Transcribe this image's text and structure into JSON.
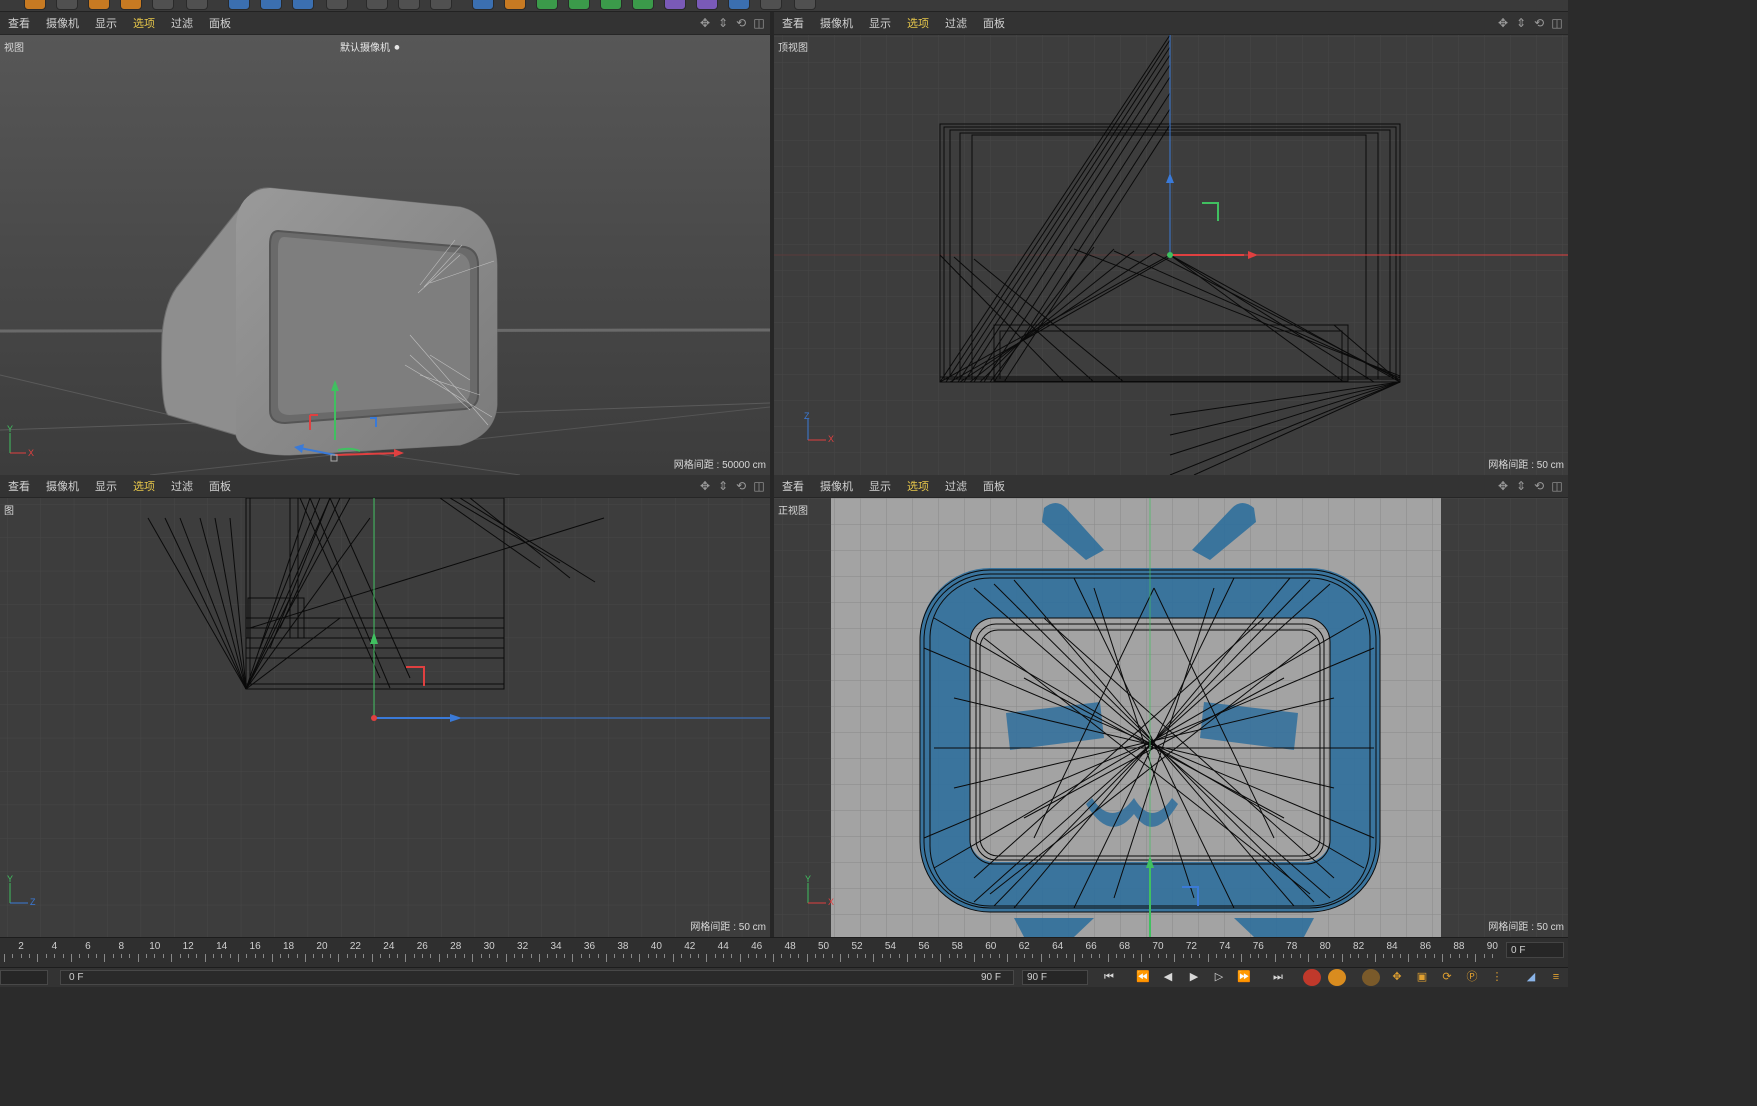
{
  "menus": [
    "查看",
    "摄像机",
    "显示",
    "选项",
    "过滤",
    "面板"
  ],
  "viewports": {
    "perspective": {
      "name": "视图",
      "camera": "默认摄像机",
      "grid_spacing": "网格间距 : 50000 cm",
      "axis_labels": [
        "Y",
        "X"
      ]
    },
    "top": {
      "name": "顶视图",
      "grid_spacing": "网格间距 : 50 cm",
      "axis_labels": [
        "Z",
        "X"
      ]
    },
    "right": {
      "name": "图",
      "grid_spacing": "网格间距 : 50 cm",
      "axis_labels": [
        "Y",
        "Z"
      ]
    },
    "front": {
      "name": "正视图",
      "grid_spacing": "网格间距 : 50 cm",
      "axis_labels": [
        "Y",
        "X"
      ]
    }
  },
  "timeline": {
    "ticks": [
      "2",
      "4",
      "6",
      "8",
      "10",
      "12",
      "14",
      "16",
      "18",
      "20",
      "22",
      "24",
      "26",
      "28",
      "30",
      "32",
      "34",
      "36",
      "38",
      "40",
      "42",
      "44",
      "46",
      "48",
      "50",
      "52",
      "54",
      "56",
      "58",
      "60",
      "62",
      "64",
      "66",
      "68",
      "70",
      "72",
      "74",
      "76",
      "78",
      "80",
      "82",
      "84",
      "86",
      "88",
      "90"
    ],
    "current_frame": "0 F"
  },
  "bottombar": {
    "start_frame": "0 F",
    "end_frame": "90 F",
    "end_frame_field": "90 F",
    "buttons": [
      "go-start",
      "prev-key",
      "prev-frame",
      "play",
      "next-frame",
      "next-key",
      "go-end"
    ]
  },
  "colors": {
    "active_menu": "#e6c64a",
    "axis_x": "#e04040",
    "axis_y": "#40c060",
    "axis_z": "#3a7ad8",
    "logo_blue": "#2f6f9c"
  }
}
